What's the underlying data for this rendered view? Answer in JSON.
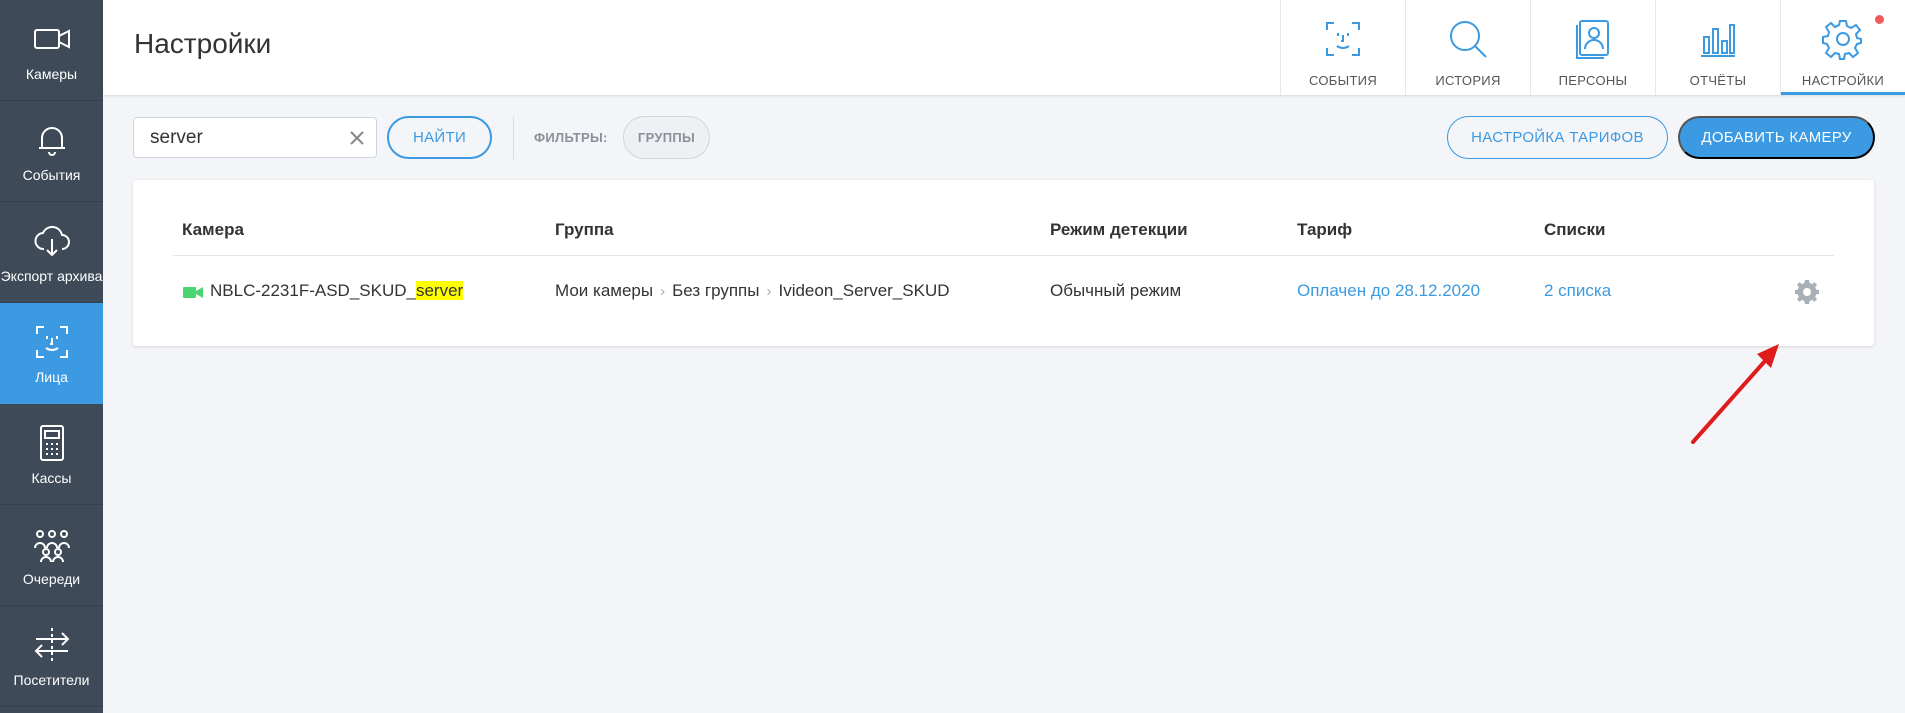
{
  "sidebar": {
    "items": [
      {
        "label": "Камеры",
        "icon": "video-camera-icon"
      },
      {
        "label": "События",
        "icon": "bell-icon"
      },
      {
        "label": "Экспорт архива",
        "icon": "cloud-download-icon"
      },
      {
        "label": "Лица",
        "icon": "face-recognition-icon"
      },
      {
        "label": "Кассы",
        "icon": "calculator-icon"
      },
      {
        "label": "Очереди",
        "icon": "people-queue-icon"
      },
      {
        "label": "Посетители",
        "icon": "arrows-exchange-icon"
      }
    ],
    "active_index": 3
  },
  "header": {
    "title": "Настройки",
    "tabs": [
      {
        "label": "СОБЫТИЯ",
        "icon": "face-scan-icon"
      },
      {
        "label": "ИСТОРИЯ",
        "icon": "search-icon"
      },
      {
        "label": "ПЕРСОНЫ",
        "icon": "person-card-icon"
      },
      {
        "label": "ОТЧЁТЫ",
        "icon": "bar-chart-icon"
      },
      {
        "label": "НАСТРОЙКИ",
        "icon": "gear-icon",
        "has_notification": true
      }
    ],
    "active_tab": "НАСТРОЙКИ"
  },
  "toolbar": {
    "search_value": "server",
    "find_label": "НАЙТИ",
    "filters_label": "ФИЛЬТРЫ:",
    "groups_label": "ГРУППЫ",
    "tariffs_label": "НАСТРОЙКА ТАРИФОВ",
    "add_camera_label": "ДОБАВИТЬ КАМЕРУ"
  },
  "table": {
    "columns": [
      "Камера",
      "Группа",
      "Режим детекции",
      "Тариф",
      "Списки"
    ],
    "rows": [
      {
        "camera_prefix": "NBLC-2231F-ASD_SKUD_",
        "camera_highlight": "server",
        "group_path": [
          "Мои камеры",
          "Без группы",
          "Ivideon_Server_SKUD"
        ],
        "detection_mode": "Обычный режим",
        "tariff": "Оплачен до 28.12.2020",
        "lists": "2 списка",
        "status_color": "#4cd471"
      }
    ]
  },
  "colors": {
    "accent": "#3b9ae1",
    "sidebar_bg": "#3e4a57",
    "highlight": "#ffff00",
    "notification": "#f25a5a",
    "annotation_arrow": "#e01b1b"
  }
}
